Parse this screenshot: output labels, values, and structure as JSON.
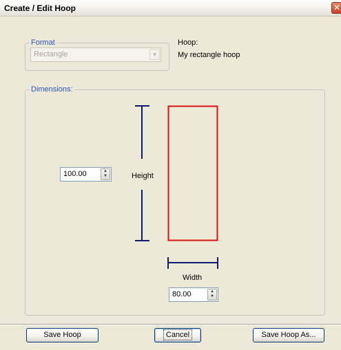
{
  "window": {
    "title": "Create / Edit Hoop",
    "close_glyph": "✕"
  },
  "format": {
    "legend": "Format",
    "selected": "Rectangle",
    "arrow_glyph": "▾"
  },
  "hoop": {
    "label": "Hoop:",
    "name": "My rectangle hoop"
  },
  "dimensions": {
    "legend": "Dimensions:",
    "height": {
      "label": "Height",
      "value": "100.00"
    },
    "width": {
      "label": "Width",
      "value": "80.00"
    },
    "spin_up_glyph": "▲",
    "spin_down_glyph": "▼",
    "preview_color": "#e01010",
    "dimension_line_color": "#0a1a6e"
  },
  "buttons": {
    "save": "Save Hoop",
    "cancel": "Cancel",
    "save_as": "Save Hoop As..."
  }
}
